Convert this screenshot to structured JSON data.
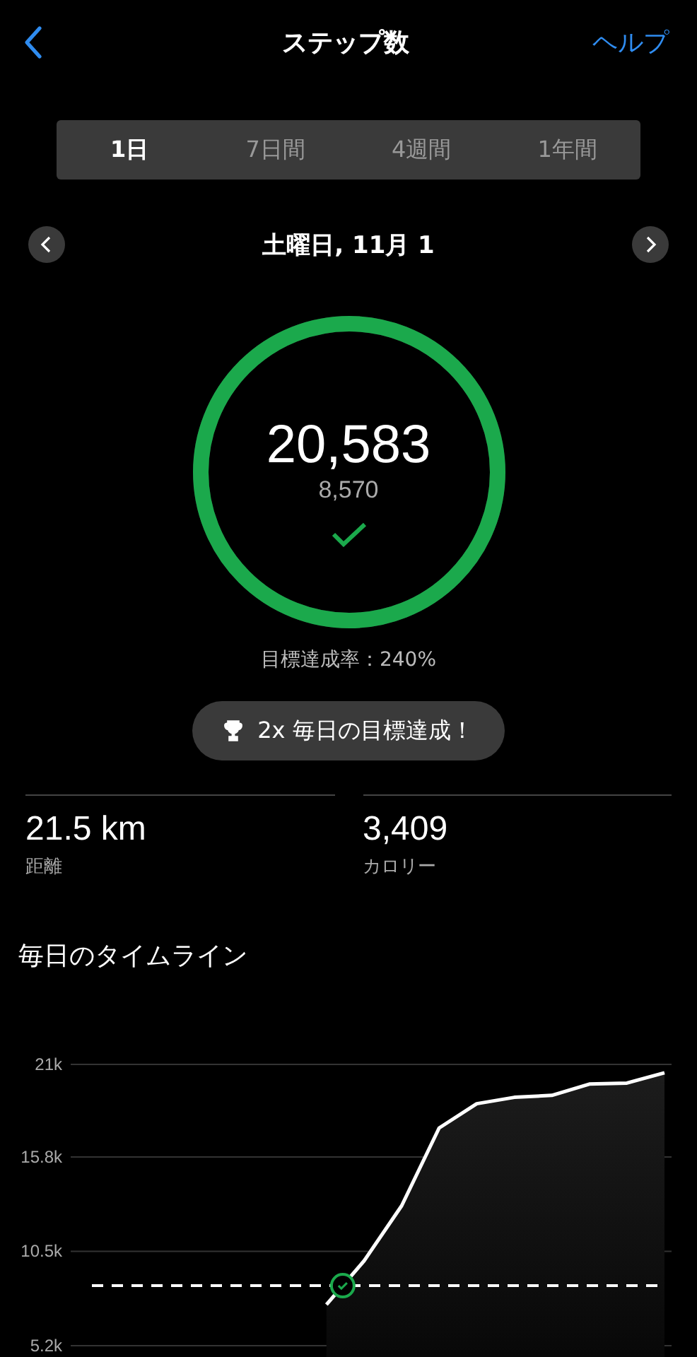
{
  "header": {
    "title": "ステップ数",
    "help": "ヘルプ"
  },
  "tabs": [
    {
      "label": "1日",
      "selected": true
    },
    {
      "label": "7日間",
      "selected": false
    },
    {
      "label": "4週間",
      "selected": false
    },
    {
      "label": "1年間",
      "selected": false
    }
  ],
  "date": "土曜日, 11月 1",
  "ring": {
    "steps": "20,583",
    "goal": "8,570",
    "level": 1,
    "achieved": true
  },
  "goal_rate": "目標達成率：240%",
  "badge": "2x 毎日の目標達成！",
  "stats": [
    {
      "value": "21.5 km",
      "label": "距離"
    },
    {
      "value": "3,409",
      "label": "カロリー"
    }
  ],
  "timeline": {
    "title": "毎日のタイムライン",
    "chart_data": {
      "type": "area",
      "grid": true,
      "ylim": [
        5200,
        21000
      ],
      "yticks": [
        {
          "value": 5200,
          "label": "5.2k"
        },
        {
          "value": 10500,
          "label": "10.5k"
        },
        {
          "value": 15800,
          "label": "15.8k"
        },
        {
          "value": 21000,
          "label": "21k"
        }
      ],
      "categories": [
        null,
        null,
        null,
        null,
        null,
        null,
        null,
        null,
        null,
        null,
        null,
        null,
        null,
        null,
        null,
        null,
        null
      ],
      "series": [
        {
          "color": "#ffffff",
          "values": [
            null,
            null,
            null,
            null,
            null,
            null,
            null,
            7510,
            9960,
            13060,
            17430,
            18790,
            19150,
            19260,
            19900,
            19950,
            20530
          ]
        }
      ],
      "ref_lines": [
        {
          "axis": "y",
          "value": 8570
        }
      ]
    }
  }
}
